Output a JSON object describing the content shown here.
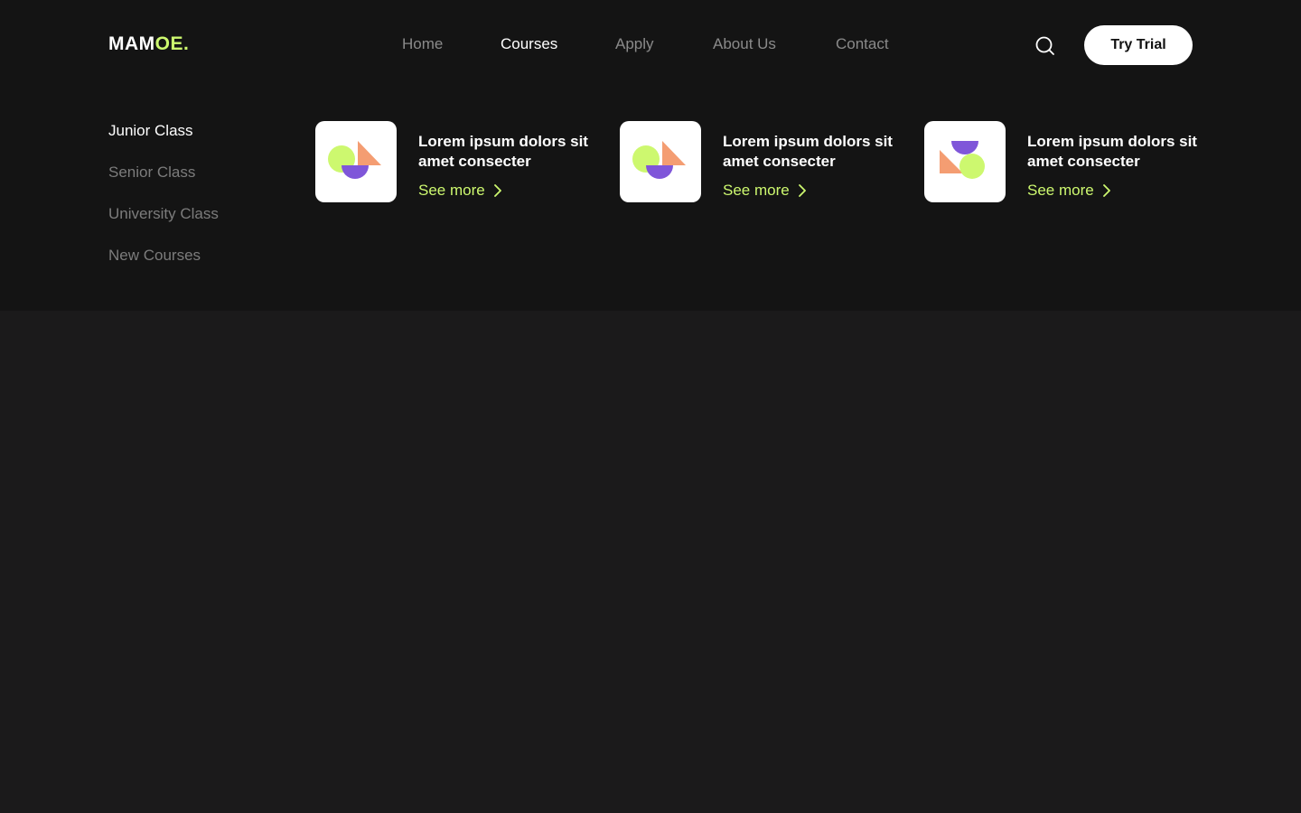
{
  "brand": {
    "logo_part1": "MAM",
    "logo_part2": "OE."
  },
  "nav": {
    "items": [
      {
        "label": "Home"
      },
      {
        "label": "Courses"
      },
      {
        "label": "Apply"
      },
      {
        "label": "About Us"
      },
      {
        "label": "Contact"
      }
    ],
    "active": "Courses"
  },
  "header_actions": {
    "search_icon": "search-icon",
    "try_trial_label": "Try Trial"
  },
  "mega_menu": {
    "categories": [
      {
        "label": "Junior Class"
      },
      {
        "label": "Senior Class"
      },
      {
        "label": "University Class"
      },
      {
        "label": "New Courses"
      }
    ],
    "active_category": "Junior Class",
    "cards": [
      {
        "title": "Lorem ipsum dolors sit amet consecter",
        "link": "See more",
        "icon": "shapes-icon"
      },
      {
        "title": "Lorem ipsum dolors sit amet consecter",
        "link": "See more",
        "icon": "shapes-icon"
      },
      {
        "title": "Lorem ipsum dolors sit amet consecter",
        "link": "See more",
        "icon": "shapes-alt-icon"
      }
    ]
  },
  "colors": {
    "accent": "#cdf86f",
    "purple": "#7f56d9",
    "orange": "#f49d72",
    "panel": "#141414",
    "page": "#1b1a1b"
  }
}
